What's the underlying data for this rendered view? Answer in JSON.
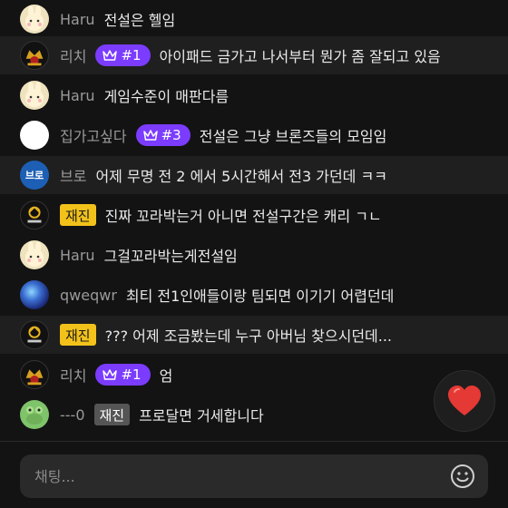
{
  "input": {
    "placeholder": "채팅..."
  },
  "messages": [
    {
      "avatar": "bunny-avatar",
      "nick": "Haru",
      "text": "전설은 헬임"
    },
    {
      "avatar": "lich-avatar",
      "nick": "리치",
      "rank": "#1",
      "text": "아이패드 금가고 나서부터 뭔가 좀 잘되고 있음"
    },
    {
      "avatar": "bunny-avatar",
      "nick": "Haru",
      "text": "게임수준이 매판다름"
    },
    {
      "avatar": "white-circle-avatar",
      "nick": "집가고싶다",
      "rank": "#3",
      "text": "전설은 그냥 브론즈들의 모임임"
    },
    {
      "avatar": "blue-avatar",
      "avatar_text": "브로",
      "nick": "브로",
      "text": "어제 무명 전 2 에서 5시간해서 전3 가던데 ㅋㅋ"
    },
    {
      "avatar": "jaejin-avatar",
      "badge": "재진",
      "text": "진짜 꼬라박는거 아니면 전설구간은 캐리 ㄱㄴ"
    },
    {
      "avatar": "bunny-avatar",
      "nick": "Haru",
      "text": "그걸꼬라박는게전설임"
    },
    {
      "avatar": "galaxy-avatar",
      "nick": "qweqwr",
      "text": "최티 전1인애들이랑 팀되면 이기기 어렵던데"
    },
    {
      "avatar": "jaejin-avatar",
      "badge": "재진",
      "text": "??? 어제 조금봤는데 누구 아버님 찾으시던데..."
    },
    {
      "avatar": "lich-avatar",
      "nick": "리치",
      "rank": "#1",
      "text": "엄"
    },
    {
      "avatar": "frog-avatar",
      "nick": "---0",
      "badge": "재진",
      "text": "프로달면 거세합니다"
    }
  ],
  "colors": {
    "rank_badge": "#7b3cff",
    "jaejin_badge": "#f2c21b",
    "heart": "#e53935"
  }
}
